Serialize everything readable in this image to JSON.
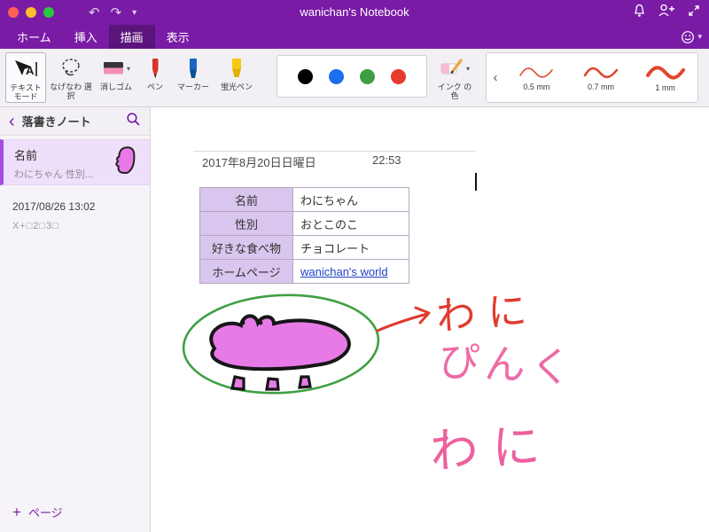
{
  "titlebar": {
    "title": "wanichan's Notebook"
  },
  "icons": {
    "undo": "↶",
    "redo": "↷",
    "caret": "▾",
    "back": "‹",
    "plus": "+",
    "smiley": "☺",
    "chevron_left": "‹"
  },
  "tabs": {
    "home": "ホーム",
    "insert": "挿入",
    "draw": "描画",
    "view": "表示"
  },
  "ribbon": {
    "text_mode": "テキスト モード",
    "lasso": "なげなわ 選択",
    "eraser": "消しゴム",
    "pen": "ペン",
    "marker": "マーカー",
    "highlighter": "蛍光ペン",
    "ink_color": "インク の色",
    "widths": {
      "w1": "0.5 mm",
      "w2": "0.7 mm",
      "w3": "1 mm"
    },
    "palette_colors": [
      "#000000",
      "#1e6ef0",
      "#3f9e42",
      "#e8392f"
    ]
  },
  "sidebar": {
    "notebook_title": "落書きノート",
    "page": {
      "title": "名前",
      "preview": "わにちゃん 性別..."
    },
    "timestamp": "2017/08/26 13:02",
    "meta": "X+□2□3□",
    "add_page": "ページ"
  },
  "canvas": {
    "date": "2017年8月20日日曜日",
    "time": "22:53",
    "table": {
      "rows": [
        {
          "label": "名前",
          "value": "わにちゃん"
        },
        {
          "label": "性別",
          "value": "おとこのこ"
        },
        {
          "label": "好きな食べ物",
          "value": "チョコレート"
        },
        {
          "label": "ホームページ",
          "value": "wanichan's world"
        }
      ]
    },
    "handwriting": {
      "word1": "わに",
      "word2": "ぴんく",
      "word3": "わに"
    }
  },
  "colors": {
    "accent_purple": "#7a1ba6",
    "handwriting_red": "#e23a2e",
    "handwriting_pink": "#ee5f9e",
    "doodle_pink": "#e87ae8",
    "doodle_green": "#3fa044"
  }
}
